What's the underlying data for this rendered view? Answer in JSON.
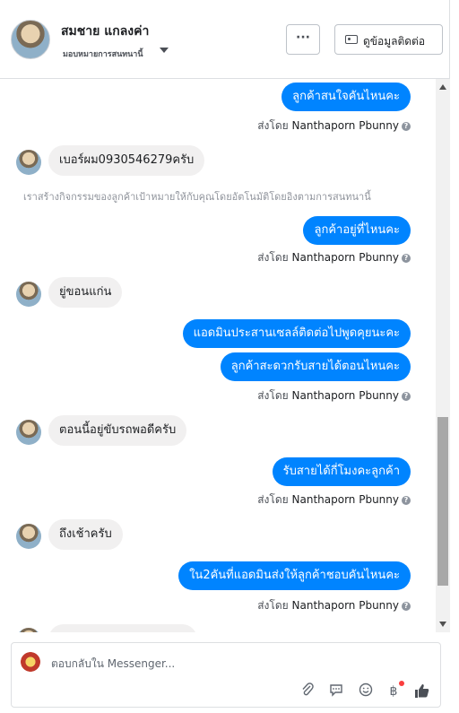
{
  "header": {
    "contact_name": "สมชาย แกลงค่า",
    "assign_label": "มอบหมายการสนทนานี้",
    "more_label": "···",
    "info_label": "ดูข้อมูลติดต่อ"
  },
  "thread": {
    "sent_by_prefix": "ส่งโดย",
    "agent": "Nanthaporn Pbunny",
    "msg1": "ลูกค้าสนใจคันไหนคะ",
    "msg2": "เบอร์ผม0930546279ครับ",
    "system_note": "เราสร้างกิจกรรมของลูกค้าเป้าหมายให้กับคุณโดยอัตโนมัติโดยอิงตามการสนทนานี้",
    "msg3": "ลูกค้าอยู่ที่ไหนคะ",
    "msg4": "ยู่ขอนแก่น",
    "msg5": "แอดมินประสานเซลล์ติดต่อไปพูดคุยนะคะ",
    "msg6": "ลูกค้าสะดวกรับสายได้ตอนไหนคะ",
    "msg7": "ตอนนี้อยู่ขับรถพอดีครับ",
    "msg8": "รับสายได้กี่โมงคะลูกค้า",
    "msg9": "ถึงเช้าครับ",
    "msg10": "ใน2คันที่แอดมินส่งให้ลูกค้าชอบคันไหนคะ"
  },
  "composer": {
    "placeholder": "ตอบกลับใน Messenger..."
  },
  "icons": {
    "attach": "paperclip-icon",
    "saved_replies": "speech-bubble-icon",
    "emoji": "smiley-icon",
    "payment": "baht-icon",
    "like": "thumbs-up-icon"
  }
}
